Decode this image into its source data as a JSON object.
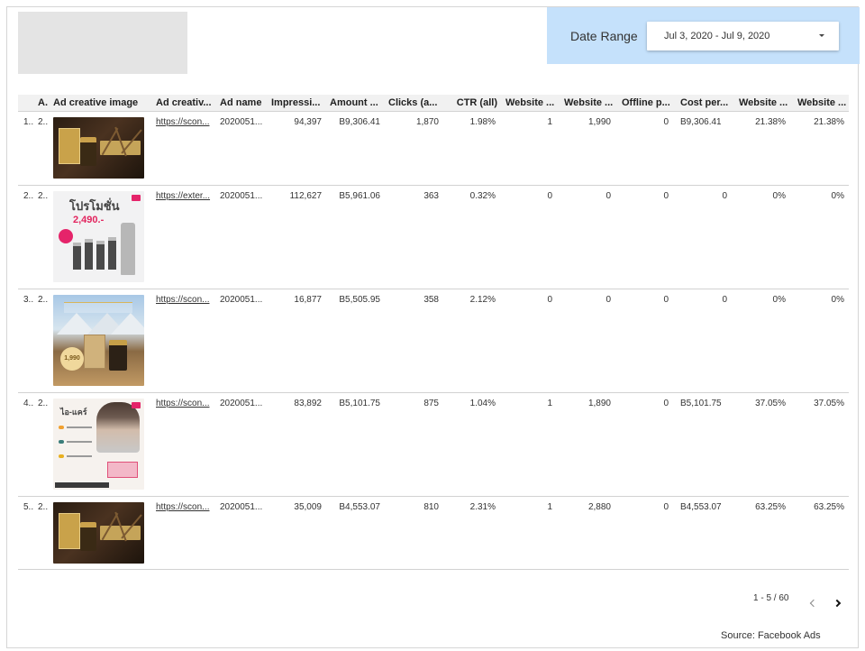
{
  "header": {
    "date_range_label": "Date Range",
    "date_range_value": "Jul 3, 2020 - Jul 9, 2020"
  },
  "table": {
    "columns": [
      "A.",
      "Ad creative image",
      "Ad creativ...",
      "Ad name",
      "Impressi...",
      "Amount ...",
      "Clicks (a...",
      "CTR (all)",
      "Website ...",
      "Website ...",
      "Offline p...",
      "Cost per...",
      "Website ...",
      "Website ..."
    ],
    "rows": [
      {
        "idx": "1..",
        "a": "2..",
        "image": "dark-product-ad",
        "creative": "https://scon...",
        "ad_name": "2020051...",
        "impressions": "94,397",
        "amount": "B9,306.41",
        "clicks": "1,870",
        "ctr": "1.98%",
        "web1": "1",
        "web2": "1,990",
        "offline": "0",
        "cost": "B9,306.41",
        "web3": "21.38%",
        "web4": "21.38%"
      },
      {
        "idx": "2..",
        "a": "2..",
        "image": "serum-promo-ad",
        "creative": "https://exter...",
        "ad_name": "2020051...",
        "impressions": "112,627",
        "amount": "B5,961.06",
        "clicks": "363",
        "ctr": "0.32%",
        "web1": "0",
        "web2": "0",
        "offline": "0",
        "cost": "0",
        "web3": "0%",
        "web4": "0%"
      },
      {
        "idx": "3..",
        "a": "2..",
        "image": "mountain-product-ad",
        "creative": "https://scon...",
        "ad_name": "2020051...",
        "impressions": "16,877",
        "amount": "B5,505.95",
        "clicks": "358",
        "ctr": "2.12%",
        "web1": "0",
        "web2": "0",
        "offline": "0",
        "cost": "0",
        "web3": "0%",
        "web4": "0%"
      },
      {
        "idx": "4..",
        "a": "2..",
        "image": "care-product-ad",
        "creative": "https://scon...",
        "ad_name": "2020051...",
        "impressions": "83,892",
        "amount": "B5,101.75",
        "clicks": "875",
        "ctr": "1.04%",
        "web1": "1",
        "web2": "1,890",
        "offline": "0",
        "cost": "B5,101.75",
        "web3": "37.05%",
        "web4": "37.05%"
      },
      {
        "idx": "5..",
        "a": "2..",
        "image": "dark-product-ad",
        "creative": "https://scon...",
        "ad_name": "2020051...",
        "impressions": "35,009",
        "amount": "B4,553.07",
        "clicks": "810",
        "ctr": "2.31%",
        "web1": "1",
        "web2": "2,880",
        "offline": "0",
        "cost": "B4,553.07",
        "web3": "63.25%",
        "web4": "63.25%"
      }
    ],
    "thumb_text": {
      "promo_title": "โปรโมชั่น",
      "promo_price": "2,490.-",
      "land_price": "1,990",
      "care_brand": "ไอ-แคร์"
    }
  },
  "pagination": {
    "range": "1 - 5 / 60"
  },
  "footer": {
    "source": "Source: Facebook Ads"
  }
}
